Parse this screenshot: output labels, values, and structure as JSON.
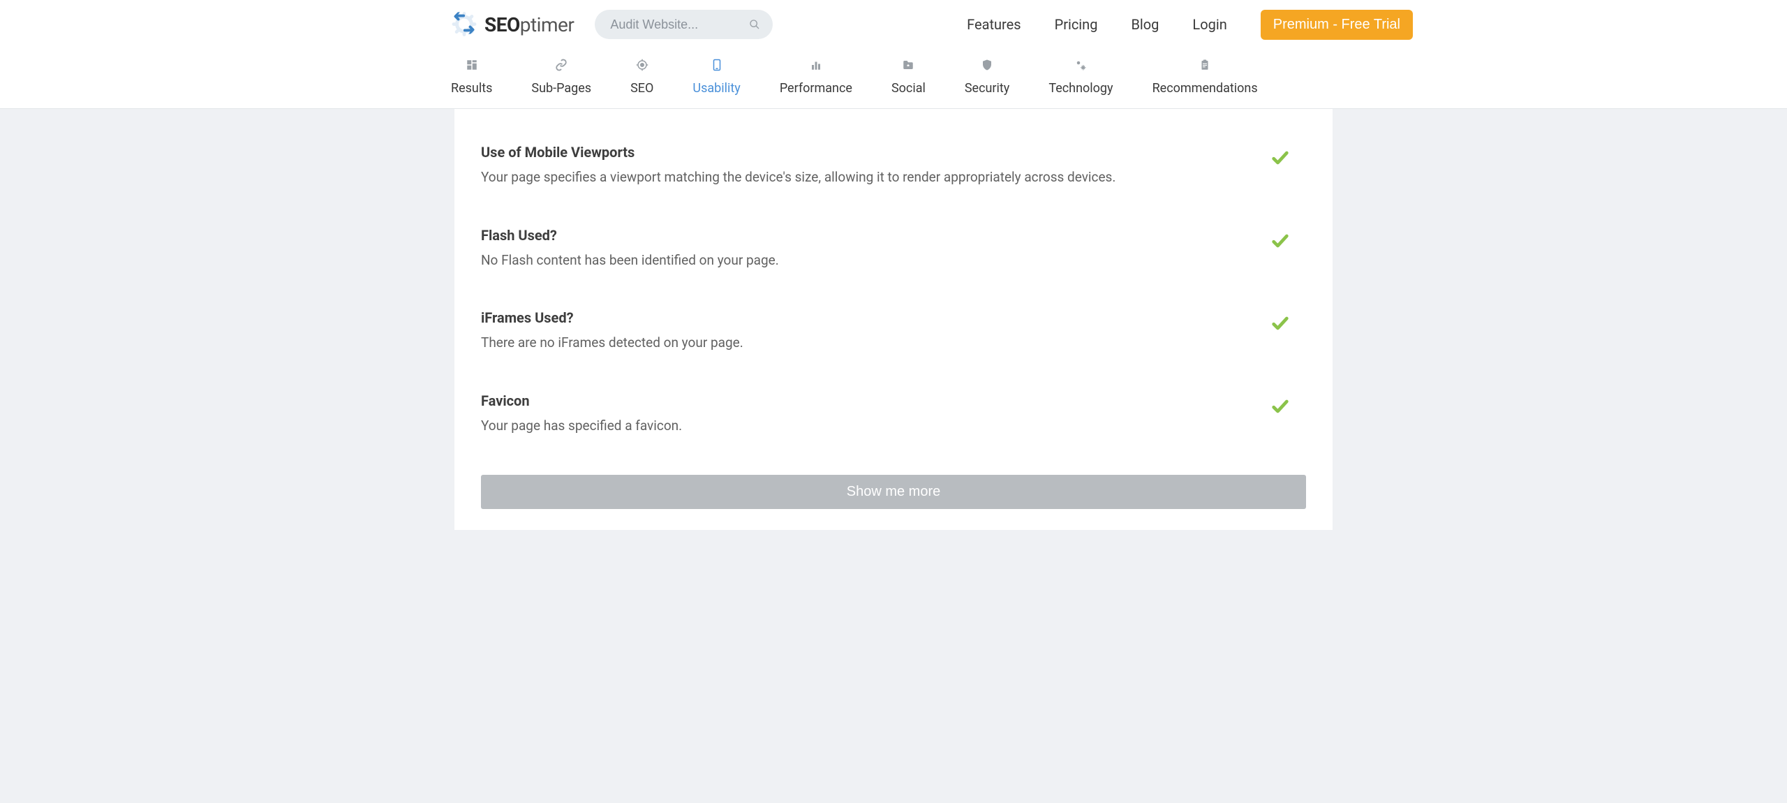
{
  "brand": {
    "name_bold": "SEO",
    "name_light": "ptimer"
  },
  "search": {
    "placeholder": "Audit Website..."
  },
  "nav": {
    "features": "Features",
    "pricing": "Pricing",
    "blog": "Blog",
    "login": "Login",
    "premium": "Premium - Free Trial"
  },
  "tabs": [
    {
      "label": "Results",
      "icon": "grid"
    },
    {
      "label": "Sub-Pages",
      "icon": "link"
    },
    {
      "label": "SEO",
      "icon": "target"
    },
    {
      "label": "Usability",
      "icon": "device",
      "active": true
    },
    {
      "label": "Performance",
      "icon": "bars"
    },
    {
      "label": "Social",
      "icon": "star-folder"
    },
    {
      "label": "Security",
      "icon": "shield"
    },
    {
      "label": "Technology",
      "icon": "gears"
    },
    {
      "label": "Recommendations",
      "icon": "clipboard"
    }
  ],
  "checks": [
    {
      "title": "Use of Mobile Viewports",
      "desc": "Your page specifies a viewport matching the device's size, allowing it to render appropriately across devices.",
      "pass": true
    },
    {
      "title": "Flash Used?",
      "desc": "No Flash content has been identified on your page.",
      "pass": true
    },
    {
      "title": "iFrames Used?",
      "desc": "There are no iFrames detected on your page.",
      "pass": true
    },
    {
      "title": "Favicon",
      "desc": "Your page has specified a favicon.",
      "pass": true
    }
  ],
  "show_more": "Show me more"
}
